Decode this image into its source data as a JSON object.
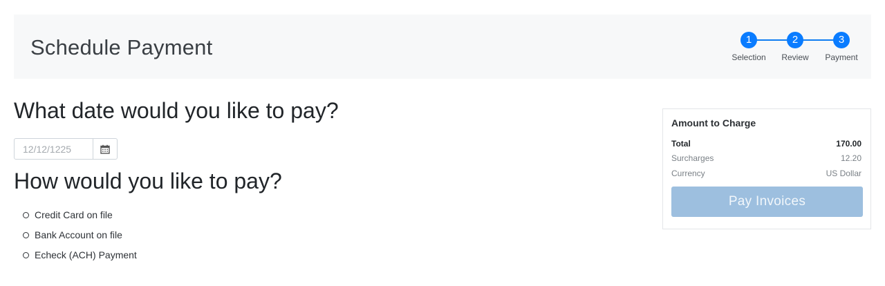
{
  "header": {
    "title": "Schedule Payment",
    "steps": [
      {
        "number": "1",
        "label": "Selection"
      },
      {
        "number": "2",
        "label": "Review"
      },
      {
        "number": "3",
        "label": "Payment"
      }
    ]
  },
  "date_section": {
    "question": "What date would you like to pay?",
    "date_placeholder": "12/12/1225",
    "calendar_icon": "calendar-icon"
  },
  "method_section": {
    "question": "How would you like to pay?",
    "options": [
      {
        "label": "Credit Card on file",
        "selected": false
      },
      {
        "label": "Bank Account on file",
        "selected": false
      },
      {
        "label": "Echeck (ACH) Payment",
        "selected": false
      }
    ]
  },
  "summary": {
    "title": "Amount to Charge",
    "rows": [
      {
        "label": "Total",
        "value": "170.00"
      },
      {
        "label": "Surcharges",
        "value": "12.20"
      },
      {
        "label": "Currency",
        "value": "US Dollar"
      }
    ],
    "pay_button": "Pay Invoices"
  },
  "colors": {
    "accent": "#0a7cff",
    "pay_button_disabled": "#9dbfdf",
    "header_bg": "#f7f8f9"
  }
}
